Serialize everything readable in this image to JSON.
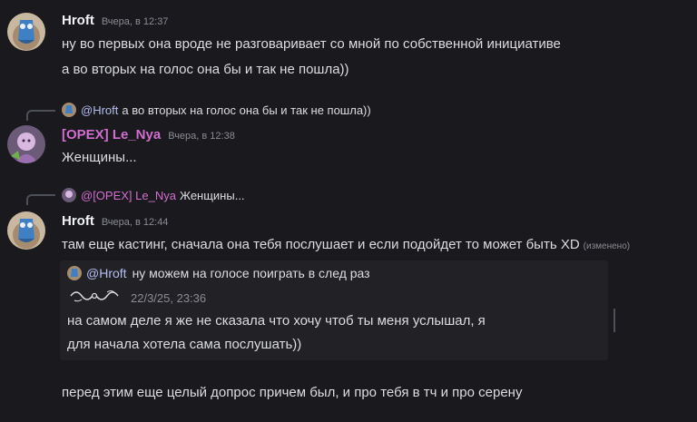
{
  "messages": [
    {
      "author": "Hroft",
      "author_color": "#f2f3f5",
      "timestamp": "Вчера, в 12:37",
      "lines": [
        "ну во первых она вроде не разговаривает со мной по собственной инициативе",
        "а во вторых на голос она бы и так не пошла))"
      ]
    },
    {
      "reply": {
        "mention": "@Hroft",
        "text": "а во вторых на голос она бы и так не пошла))"
      },
      "author": "[OPEX] Le_Nya",
      "author_color": "#d16ed0",
      "timestamp": "Вчера, в 12:38",
      "lines": [
        "Женщины..."
      ]
    },
    {
      "reply": {
        "mention": "@[OPEX] Le_Nya",
        "text": "Женщины..."
      },
      "author": "Hroft",
      "author_color": "#f2f3f5",
      "timestamp": "Вчера, в 12:44",
      "lines": [
        "там еще кастинг, сначала она тебя послушает и если подойдет то может быть XD"
      ],
      "edited_label": "(изменено)",
      "embed": {
        "mention": "@Hroft",
        "reply_text": "ну можем на голосе поиграть в след раз",
        "date": "22/3/25, 23:36",
        "body_lines": [
          "на самом деле я же не сказала что хочу чтоб ты меня услышал, я",
          "для начала хотела сама послушать))"
        ]
      },
      "after_line": "перед этим еще целый допрос причем был, и про тебя в тч и про серену"
    }
  ],
  "colors": {
    "background": "#1a1a1e",
    "text": "#dcdde1",
    "timestamp": "#8a8b93",
    "mention": "#b4bdf0",
    "accent_pink": "#d16ed0"
  }
}
